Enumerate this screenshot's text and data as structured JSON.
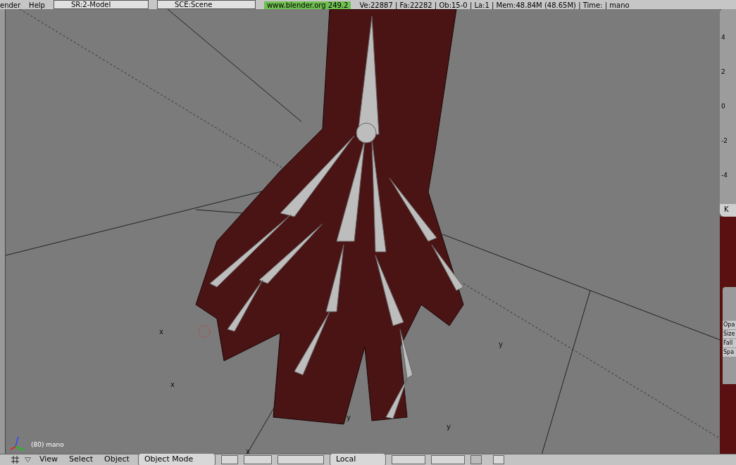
{
  "top_bar": {
    "menus": [
      "ender",
      "Help"
    ],
    "screen_field": "SR:2-Model",
    "scene_field": "SCE:Scene",
    "version": "www.blender.org 249.2",
    "stats": "Ve:22887 | Fa:22282 | Ob:15-0 | La:1 | Mem:48.84M (48.65M) | Time: | mano"
  },
  "viewport": {
    "frame_label": "(80) mano",
    "axis_labels": [
      "x",
      "x",
      "x",
      "y",
      "y",
      "y"
    ]
  },
  "graph": {
    "ticks": [
      "4",
      "2",
      "0",
      "-2",
      "-4"
    ],
    "tab": "K"
  },
  "panel": {
    "rows": [
      "Opa",
      "Size",
      "Fall",
      "Spa"
    ]
  },
  "header": {
    "menus": [
      "View",
      "Select",
      "Object"
    ],
    "mode": "Object Mode",
    "orientation": "Local"
  }
}
